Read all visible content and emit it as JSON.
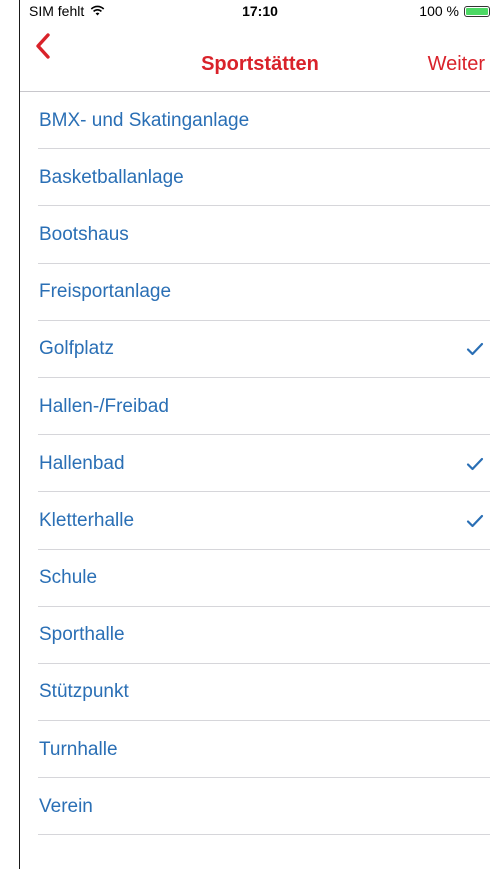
{
  "status_bar": {
    "carrier": "SIM fehlt",
    "time": "17:10",
    "battery_percent": "100 %",
    "battery_level": 1.0,
    "wifi_icon": "wifi-icon",
    "battery_color": "#4cd964"
  },
  "nav": {
    "back_icon": "chevron-left-icon",
    "title": "Sportstätten",
    "next_label": "Weiter",
    "accent_color": "#d9222a"
  },
  "list": {
    "text_color": "#2a6fb5",
    "items": [
      {
        "label": "BMX- und Skatinganlage",
        "checked": false
      },
      {
        "label": "Basketballanlage",
        "checked": false
      },
      {
        "label": "Bootshaus",
        "checked": false
      },
      {
        "label": "Freisportanlage",
        "checked": false
      },
      {
        "label": "Golfplatz",
        "checked": true
      },
      {
        "label": "Hallen-/Freibad",
        "checked": false
      },
      {
        "label": "Hallenbad",
        "checked": true
      },
      {
        "label": "Kletterhalle",
        "checked": true
      },
      {
        "label": "Schule",
        "checked": false
      },
      {
        "label": "Sporthalle",
        "checked": false
      },
      {
        "label": "Stützpunkt",
        "checked": false
      },
      {
        "label": "Turnhalle",
        "checked": false
      },
      {
        "label": "Verein",
        "checked": false
      }
    ]
  }
}
